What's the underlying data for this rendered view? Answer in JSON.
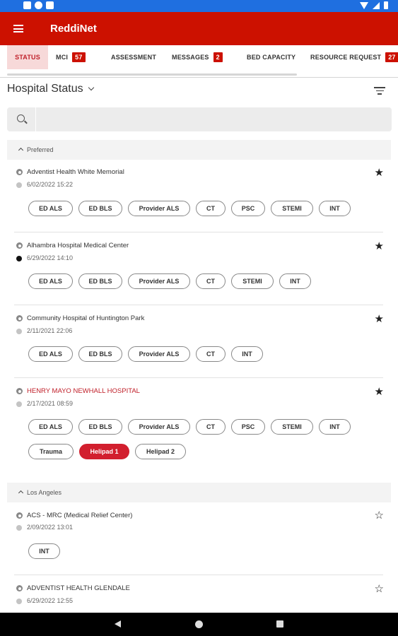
{
  "app": {
    "title": "ReddiNet"
  },
  "tabs": [
    {
      "label": "STATUS",
      "badge": ""
    },
    {
      "label": "MCI",
      "badge": "57"
    },
    {
      "label": "ASSESSMENT",
      "badge": ""
    },
    {
      "label": "MESSAGES",
      "badge": "2"
    },
    {
      "label": "BED CAPACITY",
      "badge": ""
    },
    {
      "label": "RESOURCE REQUEST",
      "badge": "27"
    }
  ],
  "header": {
    "title": "Hospital Status"
  },
  "search": {
    "placeholder": ""
  },
  "sections": [
    {
      "title": "Preferred",
      "hospitals": [
        {
          "name": "Adventist Health White Memorial",
          "time": "6/02/2022 15:22",
          "starred": true,
          "alert": false,
          "dot": "grey",
          "chips": [
            "ED ALS",
            "ED BLS",
            "Provider ALS",
            "CT",
            "PSC",
            "STEMI",
            "INT"
          ],
          "chips2": []
        },
        {
          "name": "Alhambra Hospital Medical Center",
          "time": "6/29/2022 14:10",
          "starred": true,
          "alert": false,
          "dot": "dark",
          "chips": [
            "ED ALS",
            "ED BLS",
            "Provider ALS",
            "CT",
            "STEMI",
            "INT"
          ],
          "chips2": []
        },
        {
          "name": "Community Hospital of Huntington Park",
          "time": "2/11/2021 22:06",
          "starred": true,
          "alert": false,
          "dot": "grey",
          "chips": [
            "ED ALS",
            "ED BLS",
            "Provider ALS",
            "CT",
            "INT"
          ],
          "chips2": []
        },
        {
          "name": "HENRY MAYO NEWHALL HOSPITAL",
          "time": "2/17/2021 08:59",
          "starred": true,
          "alert": true,
          "dot": "grey",
          "chips": [
            "ED ALS",
            "ED BLS",
            "Provider ALS",
            "CT",
            "PSC",
            "STEMI",
            "INT"
          ],
          "chips2": [
            "Trauma",
            "Helipad 1",
            "Helipad 2"
          ]
        }
      ]
    },
    {
      "title": "Los Angeles",
      "hospitals": [
        {
          "name": "ACS - MRC (Medical Relief Center)",
          "time": "2/09/2022 13:01",
          "starred": false,
          "alert": false,
          "dot": "grey",
          "chips": [
            "INT"
          ],
          "chips2": []
        },
        {
          "name": "ADVENTIST HEALTH GLENDALE",
          "time": "6/29/2022 12:55",
          "starred": false,
          "alert": false,
          "dot": "grey",
          "chips": [],
          "chips2": []
        }
      ]
    }
  ],
  "icons": {
    "star_filled": "★",
    "star_empty": "☆"
  },
  "colors": {
    "brand": "#cc1100",
    "alert": "#c0202a",
    "active_chip": "#d21f2e",
    "statusbar": "#1f6fe0"
  }
}
